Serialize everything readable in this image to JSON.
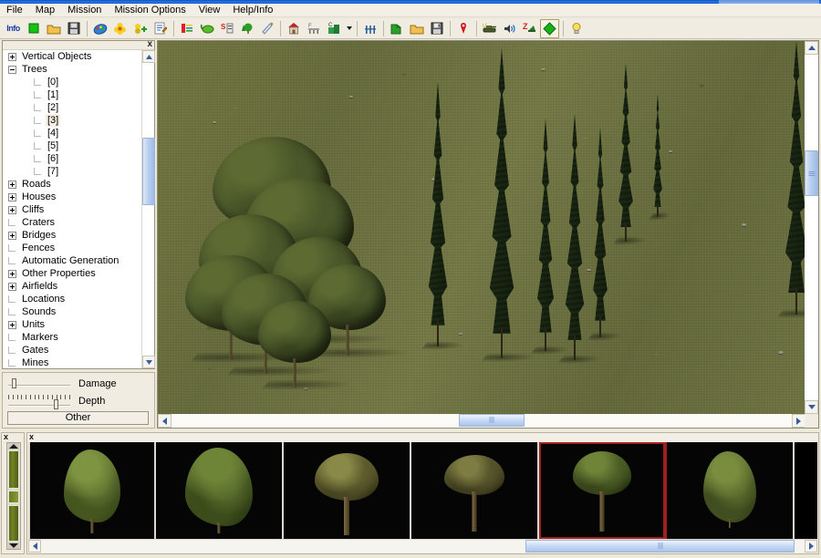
{
  "window": {
    "title": ""
  },
  "menu": {
    "items": [
      {
        "label": "File"
      },
      {
        "label": "Map"
      },
      {
        "label": "Mission"
      },
      {
        "label": "Mission Options"
      },
      {
        "label": "View"
      },
      {
        "label": "Help/Info"
      }
    ]
  },
  "toolbar": {
    "buttons": [
      {
        "name": "info-button",
        "icon": "info-icon",
        "text": "Info"
      },
      {
        "name": "stop-button",
        "icon": "green-square-icon",
        "text": ""
      },
      {
        "name": "open-folder-button",
        "icon": "open-folder-icon",
        "text": ""
      },
      {
        "name": "save-button",
        "icon": "floppy-disk-icon",
        "text": ""
      },
      {
        "name": "paint-button",
        "icon": "paint-palette-icon",
        "text": ""
      },
      {
        "name": "objects-button",
        "icon": "yellow-flower-icon",
        "text": ""
      },
      {
        "name": "add-object-button",
        "icon": "add-object-icon",
        "text": ""
      },
      {
        "name": "edit-properties-button",
        "icon": "notepad-pencil-icon",
        "text": ""
      },
      {
        "name": "front-line-button",
        "icon": "front-marker-icon",
        "text": ""
      },
      {
        "name": "water-button",
        "icon": "green-pond-icon",
        "text": ""
      },
      {
        "name": "static-object-button",
        "icon": "static-s-icon",
        "text": ""
      },
      {
        "name": "tree-tool-button",
        "icon": "tree-icon",
        "text": ""
      },
      {
        "name": "ruler-button",
        "icon": "ruler-pencil-icon",
        "text": ""
      },
      {
        "name": "house-button",
        "icon": "red-house-icon",
        "text": ""
      },
      {
        "name": "bridge-button",
        "icon": "bridge-icon",
        "text": ""
      },
      {
        "name": "cliff-button",
        "icon": "cliff-icon",
        "text": ""
      },
      {
        "name": "dropdown-button",
        "icon": "chevron-down-icon",
        "text": ""
      },
      {
        "name": "fence-button",
        "icon": "fence-icon",
        "text": ""
      },
      {
        "name": "new-mission-button",
        "icon": "new-page-icon",
        "text": ""
      },
      {
        "name": "open-mission-button",
        "icon": "open-folder-icon",
        "text": ""
      },
      {
        "name": "save-mission-button",
        "icon": "save-disk-icon",
        "text": ""
      },
      {
        "name": "marker-button",
        "icon": "red-pin-icon",
        "text": ""
      },
      {
        "name": "tank-button",
        "icon": "tank-icon",
        "text": ""
      },
      {
        "name": "sound-button",
        "icon": "speaker-icon",
        "text": ""
      },
      {
        "name": "zoom-button",
        "icon": "magnify-z-icon",
        "text": ""
      },
      {
        "name": "move-button",
        "icon": "green-diamond-icon",
        "text": ""
      },
      {
        "name": "hint-button",
        "icon": "lightbulb-icon",
        "text": ""
      }
    ]
  },
  "tree_panel": {
    "close_label": "x",
    "nodes": [
      {
        "label": "Vertical Objects",
        "indent": 0,
        "toggle": "plus",
        "selected": false
      },
      {
        "label": "Trees",
        "indent": 0,
        "toggle": "minus",
        "selected": false
      },
      {
        "label": "[0]",
        "indent": 2,
        "toggle": "leaf",
        "selected": false
      },
      {
        "label": "[1]",
        "indent": 2,
        "toggle": "leaf",
        "selected": false
      },
      {
        "label": "[2]",
        "indent": 2,
        "toggle": "leaf",
        "selected": false
      },
      {
        "label": "[3]",
        "indent": 2,
        "toggle": "leaf",
        "selected": true
      },
      {
        "label": "[4]",
        "indent": 2,
        "toggle": "leaf",
        "selected": false
      },
      {
        "label": "[5]",
        "indent": 2,
        "toggle": "leaf",
        "selected": false
      },
      {
        "label": "[6]",
        "indent": 2,
        "toggle": "leaf",
        "selected": false
      },
      {
        "label": "[7]",
        "indent": 2,
        "toggle": "leaf",
        "selected": false
      },
      {
        "label": "Roads",
        "indent": 0,
        "toggle": "plus",
        "selected": false
      },
      {
        "label": "Houses",
        "indent": 0,
        "toggle": "plus",
        "selected": false
      },
      {
        "label": "Cliffs",
        "indent": 0,
        "toggle": "plus",
        "selected": false
      },
      {
        "label": "Craters",
        "indent": 0,
        "toggle": "leaf",
        "selected": false
      },
      {
        "label": "Bridges",
        "indent": 0,
        "toggle": "plus",
        "selected": false
      },
      {
        "label": "Fences",
        "indent": 0,
        "toggle": "leaf",
        "selected": false
      },
      {
        "label": "Automatic Generation",
        "indent": 0,
        "toggle": "leaf",
        "selected": false
      },
      {
        "label": "Other Properties",
        "indent": 0,
        "toggle": "plus",
        "selected": false
      },
      {
        "label": "Airfields",
        "indent": 0,
        "toggle": "plus",
        "selected": false
      },
      {
        "label": "Locations",
        "indent": 0,
        "toggle": "leaf",
        "selected": false
      },
      {
        "label": "Sounds",
        "indent": 0,
        "toggle": "leaf",
        "selected": false
      },
      {
        "label": "Units",
        "indent": 0,
        "toggle": "plus",
        "selected": false
      },
      {
        "label": "Markers",
        "indent": 0,
        "toggle": "leaf",
        "selected": false
      },
      {
        "label": "Gates",
        "indent": 0,
        "toggle": "leaf",
        "selected": false
      },
      {
        "label": "Mines",
        "indent": 0,
        "toggle": "leaf",
        "selected": false
      }
    ]
  },
  "properties": {
    "sliders": [
      {
        "name": "damage-slider",
        "label": "Damage",
        "value_pct": 6,
        "ticks": false
      },
      {
        "name": "depth-slider",
        "label": "Depth",
        "value_pct": 80,
        "ticks": true
      }
    ],
    "other_button": "Other"
  },
  "map": {
    "grass_color": "#6b7040",
    "h_scroll_pct": 50,
    "v_scroll_pct": 33
  },
  "dock": {
    "mini_close": "x",
    "strip_close": "x",
    "h_scroll_pct": 78,
    "thumbnails": [
      {
        "name": "thumb-birch",
        "kind": "willow",
        "selected": false
      },
      {
        "name": "thumb-spruce",
        "kind": "willow2",
        "selected": false
      },
      {
        "name": "thumb-oak",
        "kind": "oak",
        "selected": false
      },
      {
        "name": "thumb-maple",
        "kind": "oak2",
        "selected": false
      },
      {
        "name": "thumb-elm",
        "kind": "oak3",
        "selected": true
      },
      {
        "name": "thumb-poplar",
        "kind": "bush",
        "selected": false
      }
    ]
  },
  "colors": {
    "selection_red": "#a02020",
    "accent_blue": "#2f7ae8",
    "panel_bg": "#ece9d8",
    "grass": "#6b7040"
  }
}
